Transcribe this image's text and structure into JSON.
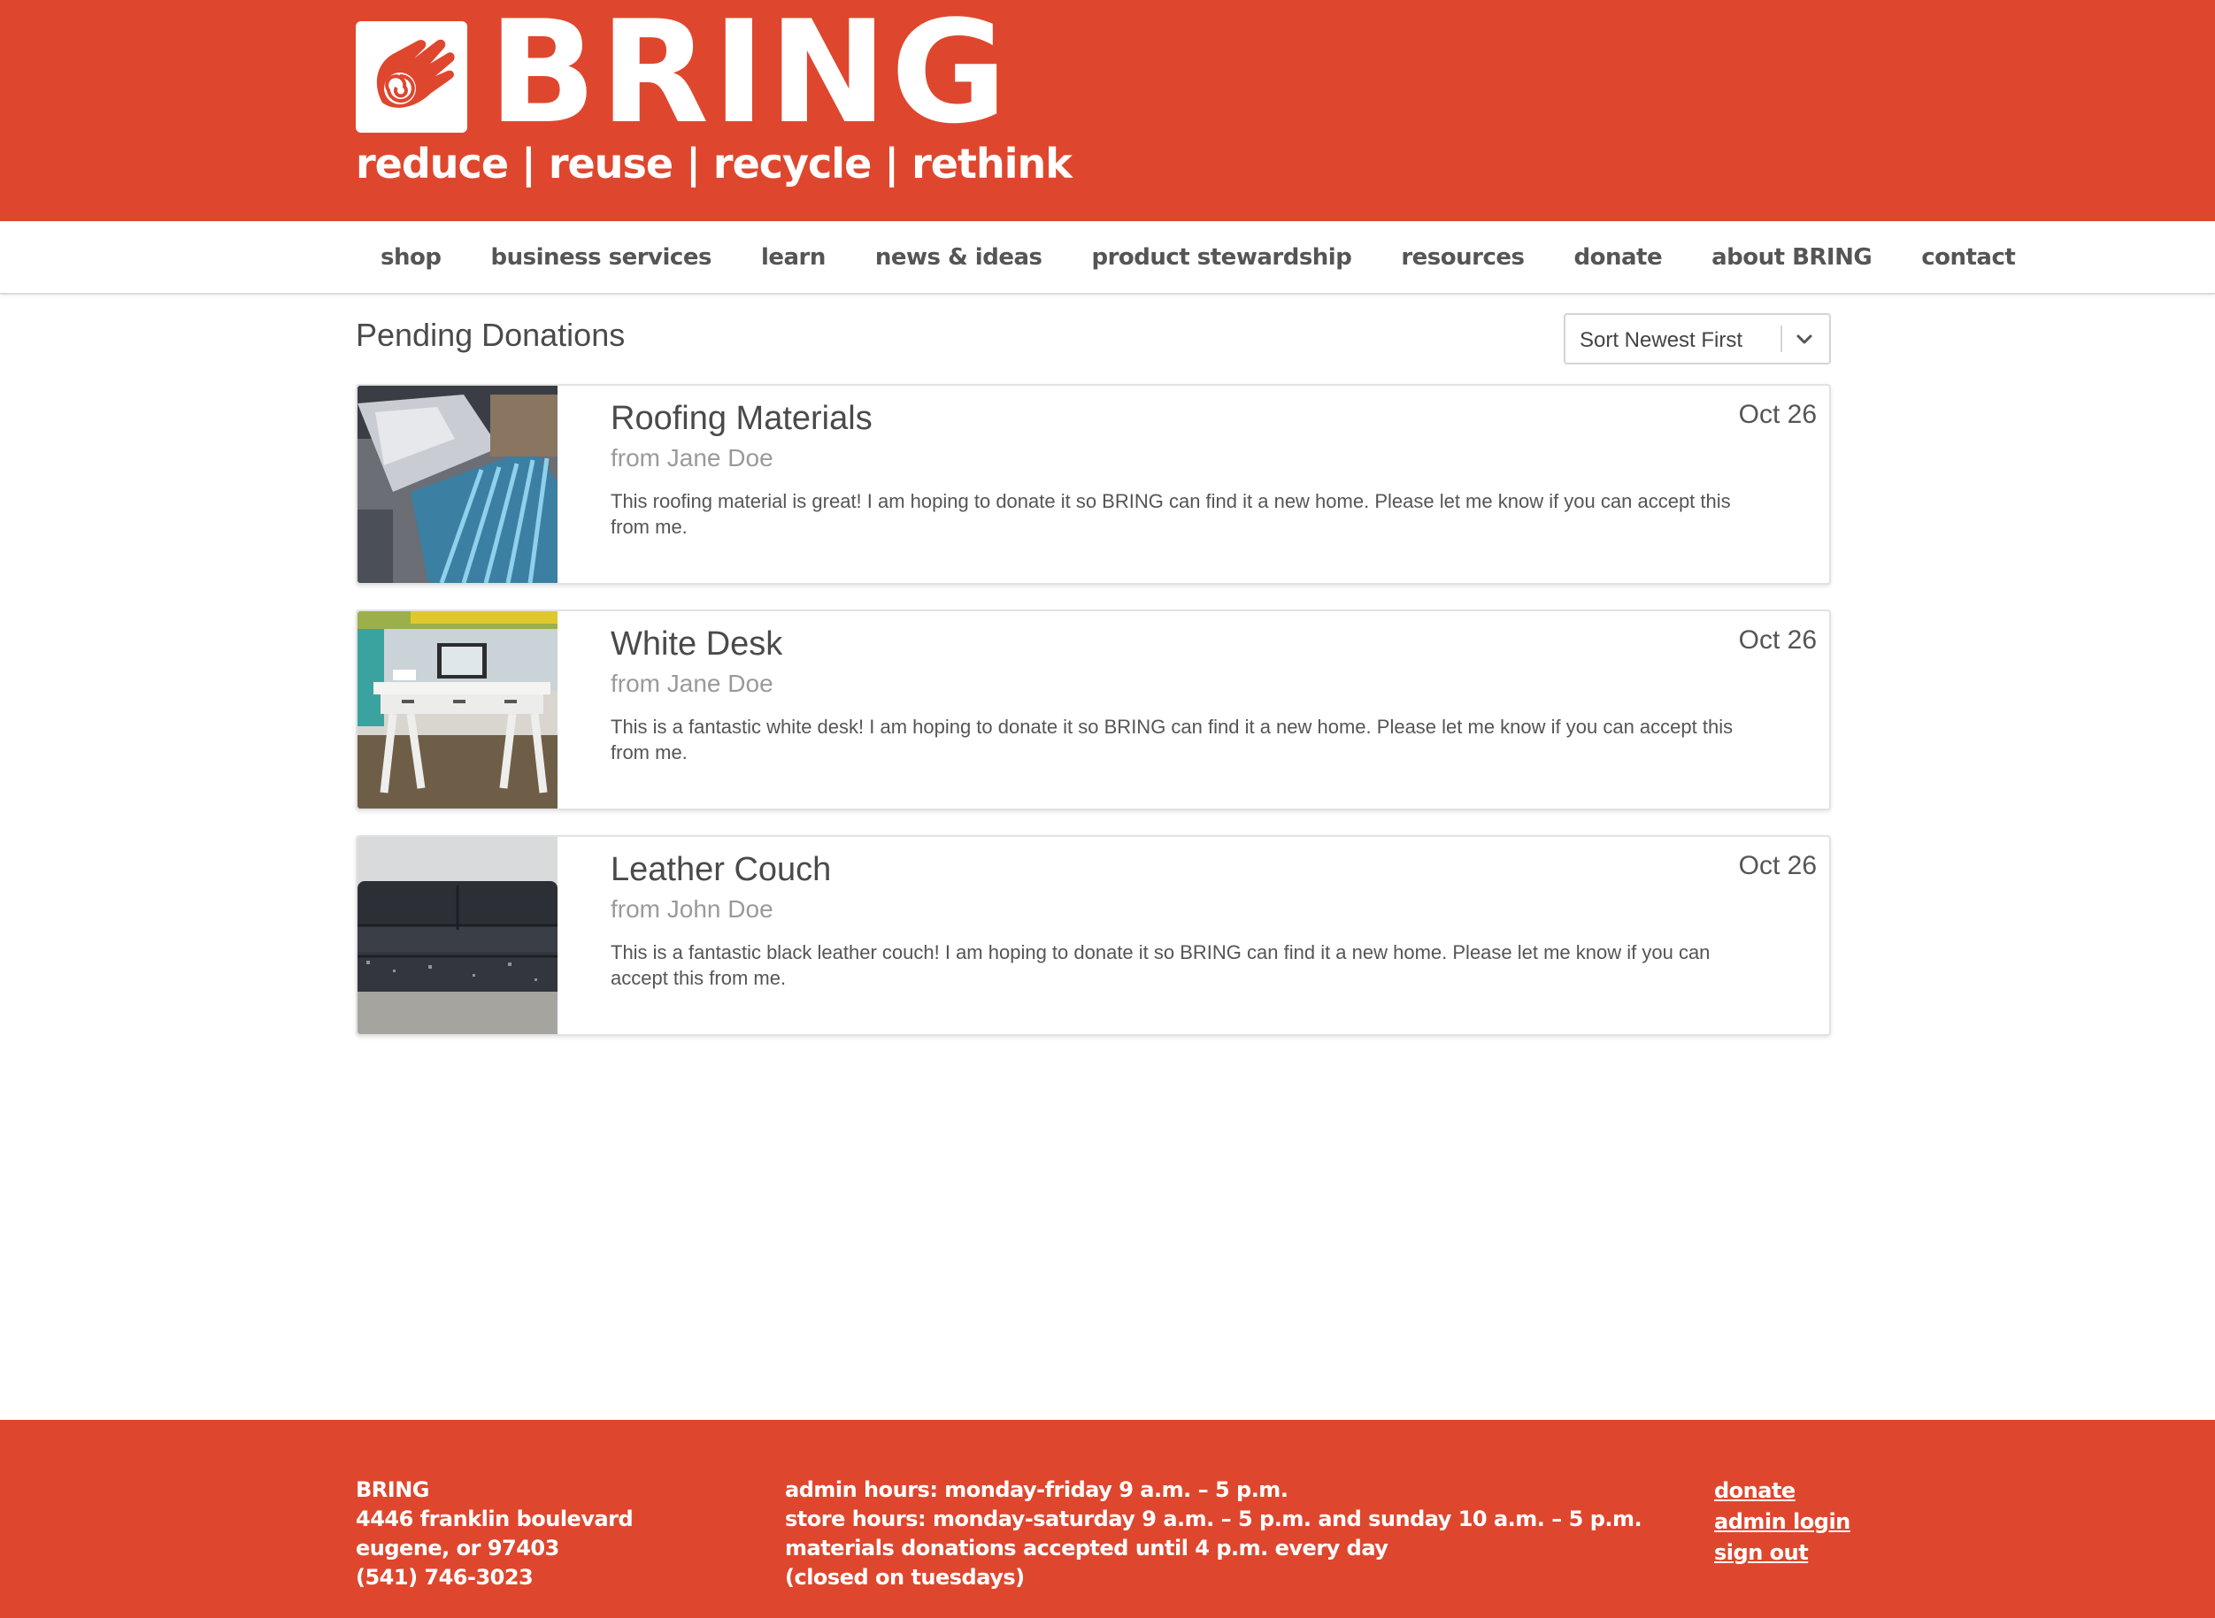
{
  "brand": {
    "name": "BRING",
    "tagline": "reduce | reuse | recycle | rethink",
    "color": "#de472e"
  },
  "nav": {
    "items": [
      {
        "label": "shop"
      },
      {
        "label": "business services"
      },
      {
        "label": "learn"
      },
      {
        "label": "news & ideas"
      },
      {
        "label": "product stewardship"
      },
      {
        "label": "resources"
      },
      {
        "label": "donate"
      },
      {
        "label": "about BRING"
      },
      {
        "label": "contact"
      }
    ]
  },
  "main": {
    "title": "Pending Donations",
    "sort": {
      "selected": "Sort Newest First",
      "icon": "chevron-down-icon"
    },
    "donations": [
      {
        "title": "Roofing Materials",
        "from": "from Jane Doe",
        "description": "This roofing material is great! I am hoping to donate it so BRING can find it a new home. Please let me know if you can accept this from me.",
        "date": "Oct 26"
      },
      {
        "title": "White Desk",
        "from": "from Jane Doe",
        "description": "This is a fantastic white desk! I am hoping to donate it so BRING can find it a new home. Please let me know if you can accept this from me.",
        "date": "Oct 26"
      },
      {
        "title": "Leather Couch",
        "from": "from John Doe",
        "description": "This is a fantastic black leather couch! I am hoping to donate it so BRING can find it a new home. Please let me know if you can accept this from me.",
        "date": "Oct 26"
      }
    ]
  },
  "footer": {
    "address": {
      "name": "BRING",
      "street": "4446 franklin boulevard",
      "city": "eugene, or 97403",
      "phone": "(541) 746-3023"
    },
    "hours": {
      "admin": "admin hours: monday-friday 9 a.m. – 5 p.m.",
      "store": "store hours: monday-saturday 9 a.m. – 5 p.m. and sunday 10 a.m. – 5 p.m.",
      "materials": "materials donations accepted until 4 p.m. every day",
      "closed": "(closed on tuesdays)"
    },
    "links": {
      "donate": "donate",
      "admin_login": "admin login",
      "sign_out": "sign out"
    }
  }
}
